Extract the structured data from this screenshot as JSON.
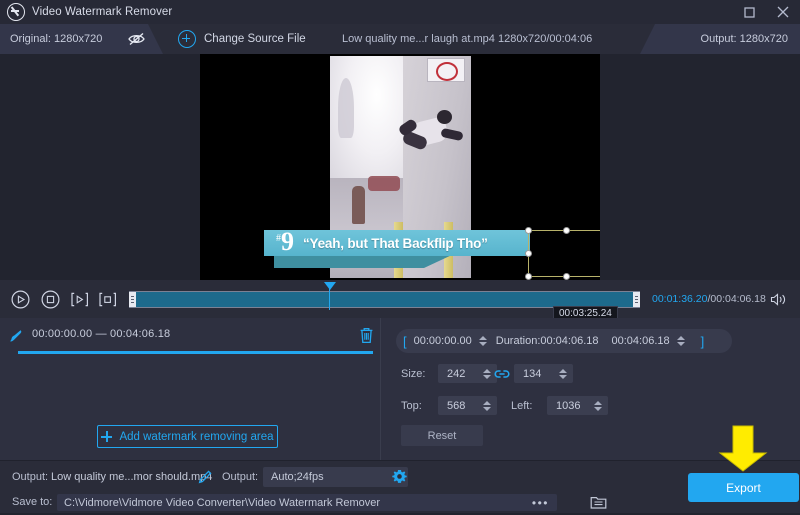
{
  "window": {
    "title": "Video Watermark Remover",
    "logo_icon": "no-watermark-icon",
    "controls": [
      {
        "name": "maximize-button",
        "icon": "maximize-icon"
      },
      {
        "name": "close-button",
        "icon": "close-icon"
      }
    ]
  },
  "infobar": {
    "original_label": "Original: 1280x720",
    "eye_icon": "eye-off-icon",
    "add_icon": "plus-circle-icon",
    "change_source_label": "Change Source File",
    "file_name": "Low quality me...r laugh at.mp4",
    "file_meta": "1280x720/00:04:06",
    "output_label": "Output: 1280x720"
  },
  "preview": {
    "subtitle_hash": "#",
    "subtitle_number": "9",
    "subtitle_text": "“Yeah, but That Backflip Tho”",
    "selection_name": "watermark-selection-box"
  },
  "transport": {
    "play_icon": "play-circle-icon",
    "stop_icon": "stop-circle-icon",
    "mark_in_icon": "set-start-icon",
    "mark_out_icon": "set-end-icon",
    "tooltip_time": "00:03:25.24",
    "current_time": "00:01:36.20",
    "total_time": "/00:04:06.18",
    "volume_icon": "volume-icon",
    "playhead_percent": 39
  },
  "watermark_area": {
    "brush_icon": "brush-icon",
    "time_range": "00:00:00.00 — 00:04:06.18",
    "delete_icon": "trash-icon",
    "add_button_label": "Add watermark removing area",
    "add_button_icon": "plus-icon"
  },
  "trim": {
    "bracket_open": "[",
    "start_time": "00:00:00.00",
    "duration_label": "Duration:00:04:06.18",
    "end_time": "00:04:06.18",
    "bracket_close": "]"
  },
  "geometry": {
    "size_label": "Size:",
    "width": "242",
    "height": "134",
    "link_icon": "chain-link-icon",
    "top_label": "Top:",
    "top": "568",
    "left_label": "Left:",
    "left": "1036",
    "reset_label": "Reset"
  },
  "bottom": {
    "output_name_label": "Output:",
    "output_name_value": "Low quality me...mor should.mp4",
    "edit_icon": "pencil-icon",
    "output_format_label": "Output:",
    "output_format_value": "Auto;24fps",
    "settings_icon": "gear-icon",
    "save_to_label": "Save to:",
    "save_to_path": "C:\\Vidmore\\Vidmore Video Converter\\Video Watermark Remover",
    "browse_icon": "ellipsis-icon",
    "folder_icon": "folder-icon",
    "export_label": "Export",
    "annotation_icon": "down-arrow-annotation"
  },
  "colors": {
    "accent": "#22a7f0",
    "panel": "#2e3040",
    "bar": "#2a2c39",
    "tab": "#33364a",
    "annotation": "#ffec00",
    "selection": "#b7b26a"
  }
}
